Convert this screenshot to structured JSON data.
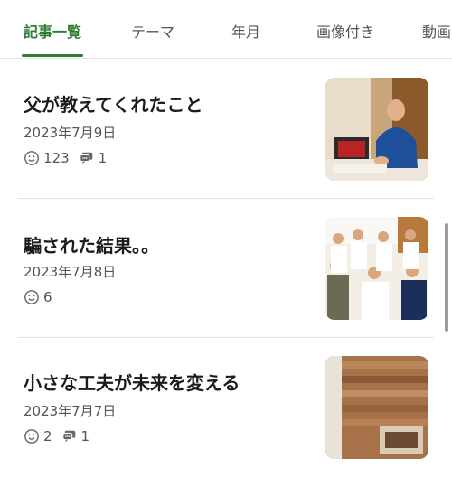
{
  "tabs": [
    {
      "label": "記事一覧",
      "active": true
    },
    {
      "label": "テーマ",
      "active": false
    },
    {
      "label": "年月",
      "active": false
    },
    {
      "label": "画像付き",
      "active": false
    },
    {
      "label": "動画",
      "active": false
    }
  ],
  "colors": {
    "accent": "#2e7d32"
  },
  "articles": [
    {
      "title": "父が教えてくれたこと",
      "date": "2023年7月9日",
      "likes": "123",
      "comments": "1",
      "thumb_icon": "man-in-blue-shirt-photo"
    },
    {
      "title": "騙された結果。。",
      "date": "2023年7月8日",
      "likes": "6",
      "comments": "",
      "thumb_icon": "group-photo"
    },
    {
      "title": "小さな工夫が未来を変える",
      "date": "2023年7月7日",
      "likes": "2",
      "comments": "1",
      "thumb_icon": "wooden-wall-photo"
    }
  ]
}
